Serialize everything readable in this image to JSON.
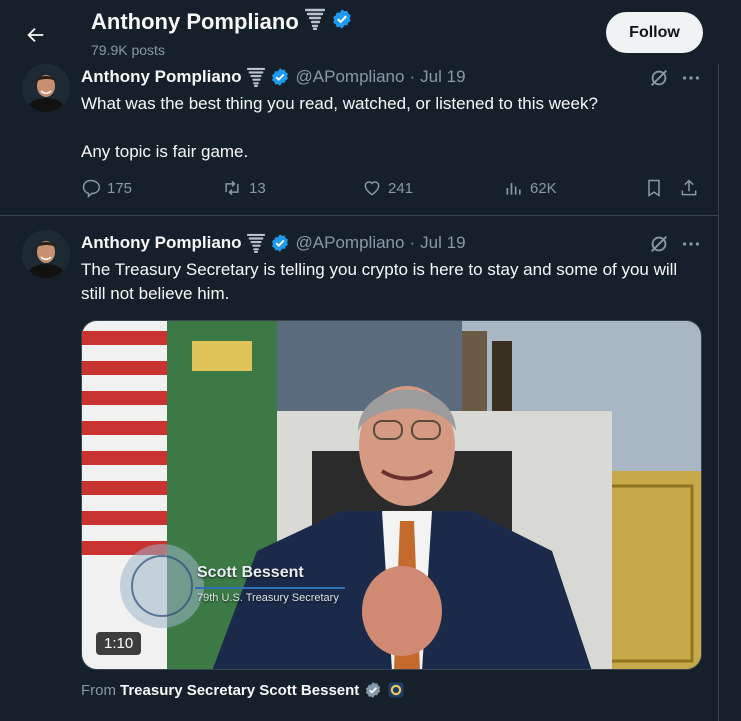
{
  "header": {
    "title": "Anthony Pompliano",
    "posts": "79.9K posts",
    "follow_label": "Follow"
  },
  "tweets": [
    {
      "name": "Anthony Pompliano",
      "handle": "@APompliano",
      "dot": "·",
      "date": "Jul 19",
      "text1": "What was the best thing you read, watched, or listened to this week?",
      "text2": "Any topic is fair game.",
      "replies": "175",
      "reposts": "13",
      "likes": "241",
      "views": "62K"
    },
    {
      "name": "Anthony Pompliano",
      "handle": "@APompliano",
      "dot": "·",
      "date": "Jul 19",
      "text1": "The Treasury Secretary is telling you crypto is here to stay and some of you will still not believe him.",
      "media": {
        "duration": "1:10",
        "lower_third_name": "Scott Bessent",
        "lower_third_title": "79th U.S. Treasury Secretary"
      },
      "from_prefix": "From",
      "from_name": "Treasury Secretary Scott Bessent"
    }
  ],
  "colors": {
    "background": "#15202b",
    "verified": "#1d9bf0",
    "muted": "#8b98a5",
    "border": "#38444d",
    "government_badge": "#829aab"
  },
  "icons": [
    "back-arrow-icon",
    "tornado-icon",
    "verified-badge-icon",
    "grok-icon",
    "more-icon",
    "reply-icon",
    "repost-icon",
    "like-icon",
    "views-icon",
    "bookmark-icon",
    "share-icon",
    "gov-badge-icon",
    "treasury-seal-icon"
  ]
}
